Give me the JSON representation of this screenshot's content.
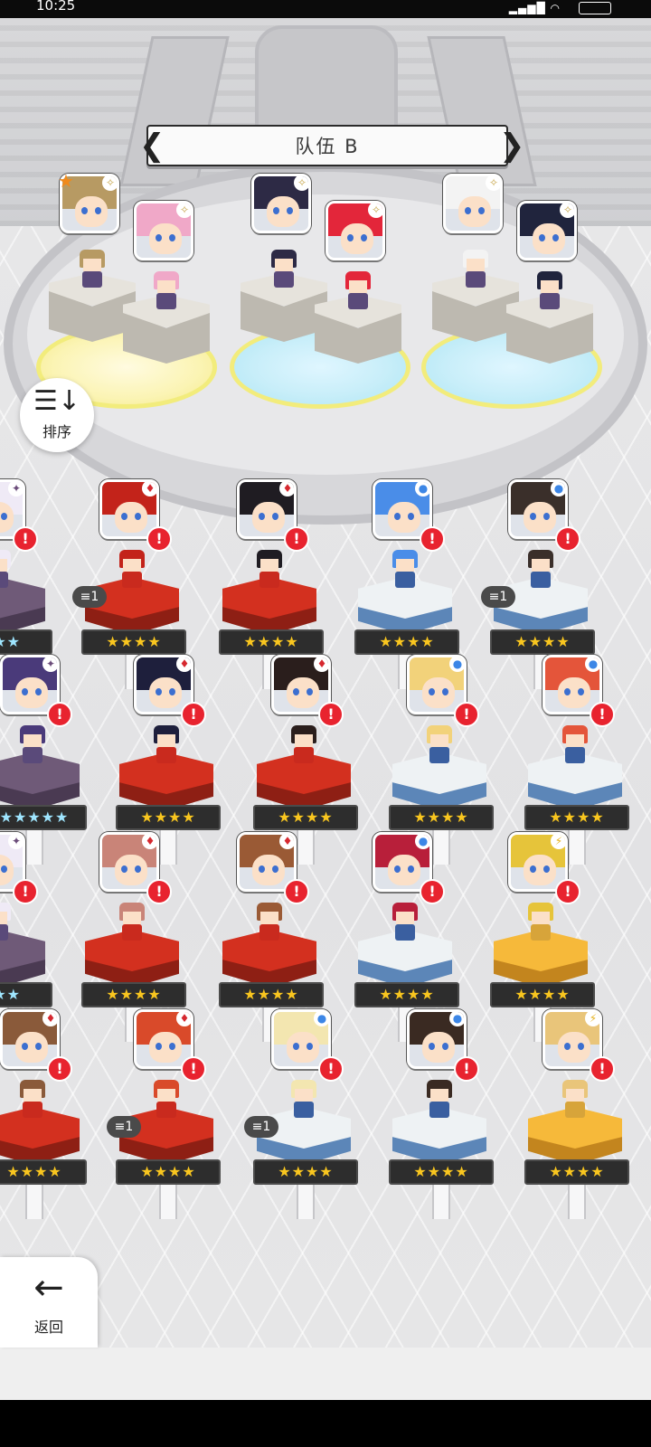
{
  "status_bar": {
    "time": "10:25"
  },
  "header": {
    "team_name": "队伍 B"
  },
  "buttons": {
    "sort": "排序",
    "back": "返回"
  },
  "colors": {
    "red_pedestal": "#d3301f",
    "white_pedestal": "#eef2f4",
    "purple_pedestal": "#6f5a78",
    "gold_pedestal": "#f6b93a",
    "alert": "#e8232f",
    "star": "#f9c61f"
  },
  "team_members": [
    {
      "hair": "#b79a63",
      "mark": "✧",
      "star_badge": true
    },
    {
      "hair": "#f0a8c8",
      "mark": "✧"
    },
    {
      "hair": "#2d2a45",
      "mark": "✧"
    },
    {
      "hair": "#e3263a",
      "mark": "✧"
    },
    {
      "hair": "#f3f3f3",
      "mark": "✧"
    },
    {
      "hair": "#20243d",
      "mark": "✧"
    }
  ],
  "roster": [
    {
      "hair": "#efeaf6",
      "mark": "✦",
      "mark_color": "#6b4c7a",
      "pedestal": "purple",
      "stars": "★★★",
      "rainbow": true,
      "partial": true
    },
    {
      "hair": "#c3231a",
      "mark": "♦",
      "mark_color": "#d6282f",
      "pedestal": "red",
      "stars": "★★★★",
      "tag": "1"
    },
    {
      "hair": "#1f1c22",
      "mark": "♦",
      "mark_color": "#d6282f",
      "pedestal": "red",
      "stars": "★★★★"
    },
    {
      "hair": "#4a8de8",
      "mark": "●",
      "mark_color": "#3c86e6",
      "pedestal": "white",
      "stars": "★★★★"
    },
    {
      "hair": "#3a2f2a",
      "mark": "●",
      "mark_color": "#3c86e6",
      "pedestal": "white",
      "stars": "★★★★",
      "tag": "1"
    },
    {
      "hair": "#4a3a7a",
      "mark": "✦",
      "mark_color": "#6b4c7a",
      "pedestal": "purple",
      "stars": "★★★★★",
      "rainbow": true
    },
    {
      "hair": "#1e1f3c",
      "mark": "♦",
      "mark_color": "#d6282f",
      "pedestal": "red",
      "stars": "★★★★"
    },
    {
      "hair": "#2a1e1c",
      "mark": "♦",
      "mark_color": "#d6282f",
      "pedestal": "red",
      "stars": "★★★★"
    },
    {
      "hair": "#f2d27a",
      "mark": "●",
      "mark_color": "#3c86e6",
      "pedestal": "white",
      "stars": "★★★★"
    },
    {
      "hair": "#e4553a",
      "mark": "●",
      "mark_color": "#3c86e6",
      "pedestal": "white",
      "stars": "★★★★"
    },
    {
      "hair": "#efeaf6",
      "mark": "✦",
      "mark_color": "#6b4c7a",
      "pedestal": "purple",
      "stars": "★★★",
      "rainbow": true,
      "partial": true
    },
    {
      "hair": "#c98478",
      "mark": "♦",
      "mark_color": "#d6282f",
      "pedestal": "red",
      "stars": "★★★★"
    },
    {
      "hair": "#9a5a35",
      "mark": "♦",
      "mark_color": "#d6282f",
      "pedestal": "red",
      "stars": "★★★★"
    },
    {
      "hair": "#b81f3a",
      "mark": "●",
      "mark_color": "#3c86e6",
      "pedestal": "white",
      "stars": "★★★★"
    },
    {
      "hair": "#e6c43a",
      "mark": "⚡",
      "mark_color": "#e6b21e",
      "pedestal": "gold",
      "stars": "★★★★"
    },
    {
      "hair": "#8a5a3a",
      "mark": "♦",
      "mark_color": "#d6282f",
      "pedestal": "red",
      "stars": "★★★★"
    },
    {
      "hair": "#d94a2a",
      "mark": "♦",
      "mark_color": "#d6282f",
      "pedestal": "red",
      "stars": "★★★★",
      "tag": "1"
    },
    {
      "hair": "#f3e6b0",
      "mark": "●",
      "mark_color": "#3c86e6",
      "pedestal": "white",
      "stars": "★★★★",
      "tag": "1"
    },
    {
      "hair": "#3a2a22",
      "mark": "●",
      "mark_color": "#3c86e6",
      "pedestal": "white",
      "stars": "★★★★"
    },
    {
      "hair": "#e9c57a",
      "mark": "⚡",
      "mark_color": "#e6b21e",
      "pedestal": "gold",
      "stars": "★★★★"
    }
  ]
}
